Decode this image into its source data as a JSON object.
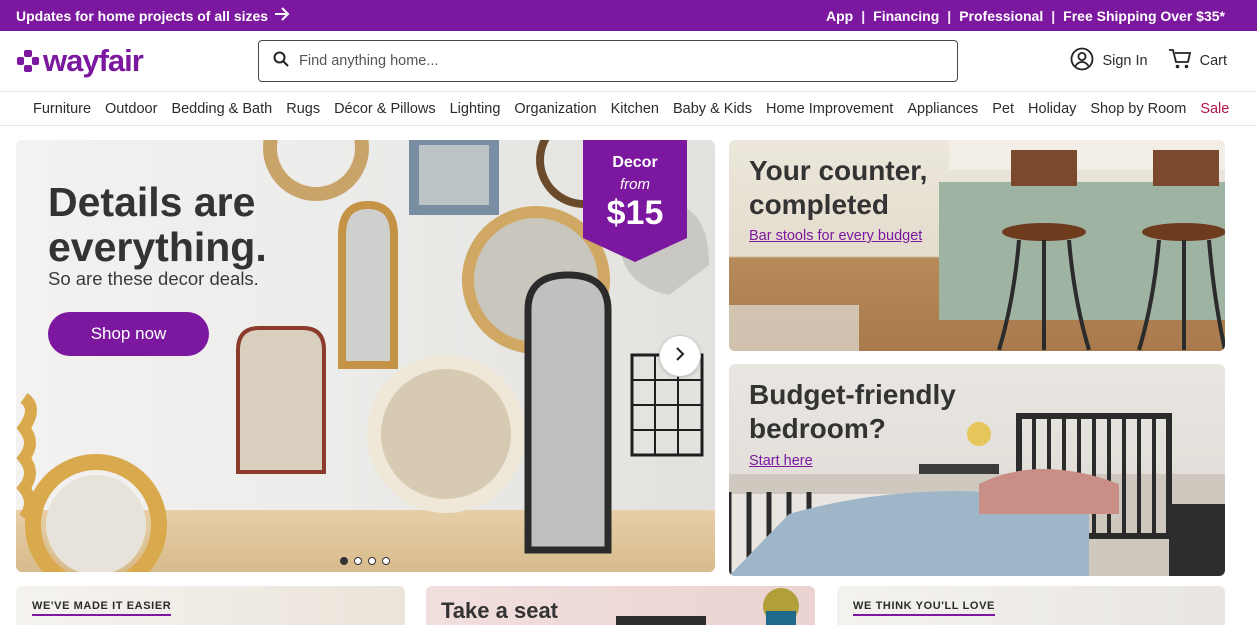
{
  "promo": {
    "message": "Updates for home projects of all sizes",
    "links": [
      "App",
      "Financing",
      "Professional",
      "Free Shipping Over $35*"
    ]
  },
  "header": {
    "logo": "wayfair",
    "search_placeholder": "Find anything home...",
    "sign_in": "Sign In",
    "cart": "Cart"
  },
  "nav": [
    "Furniture",
    "Outdoor",
    "Bedding & Bath",
    "Rugs",
    "Décor & Pillows",
    "Lighting",
    "Organization",
    "Kitchen",
    "Baby & Kids",
    "Home Improvement",
    "Appliances",
    "Pet",
    "Holiday",
    "Shop by Room",
    "Sale"
  ],
  "hero": {
    "title": "Details are everything.",
    "subtitle": "So are these decor deals.",
    "button": "Shop now",
    "badge_line1": "Decor",
    "badge_line2": "from",
    "badge_price": "$15",
    "slide_count": 4,
    "active_slide": 1
  },
  "cards": [
    {
      "title": "Your counter, completed",
      "link": "Bar stools for every budget"
    },
    {
      "title": "Budget-friendly bedroom?",
      "link": "Start here"
    }
  ],
  "bottom": {
    "card1_eyebrow": "WE'VE MADE IT EASIER",
    "card2_title": "Take a seat",
    "card3_eyebrow": "WE THINK YOU'LL LOVE"
  },
  "colors": {
    "brand": "#7b189f",
    "sale": "#b1144a"
  }
}
